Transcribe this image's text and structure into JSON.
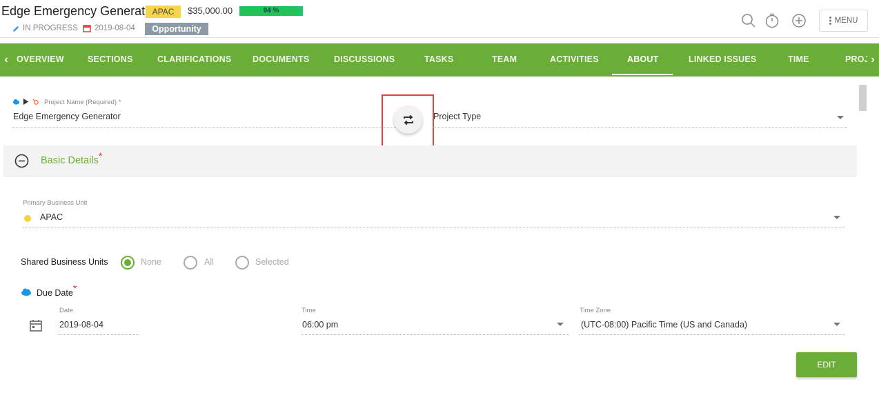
{
  "header": {
    "title": "Edge Emergency Generator",
    "business_unit_badge": "APAC",
    "amount": "$35,000.00",
    "progress": {
      "percent": 94,
      "label": "94 %"
    },
    "status": "IN PROGRESS",
    "date": "2019-08-04",
    "type_badge": "Opportunity",
    "menu_label": "MENU"
  },
  "nav": {
    "tabs": [
      {
        "label": "OVERVIEW"
      },
      {
        "label": "SECTIONS"
      },
      {
        "label": "CLARIFICATIONS"
      },
      {
        "label": "DOCUMENTS"
      },
      {
        "label": "DISCUSSIONS"
      },
      {
        "label": "TASKS"
      },
      {
        "label": "TEAM"
      },
      {
        "label": "ACTIVITIES"
      },
      {
        "label": "ABOUT"
      },
      {
        "label": "LINKED ISSUES"
      },
      {
        "label": "TIME"
      },
      {
        "label": "PROJECT"
      }
    ],
    "active": "ABOUT"
  },
  "form": {
    "project_name_label": "Project Name (Required) *",
    "project_name_value": "Edge Emergency Generator",
    "project_type_placeholder": "Project Type",
    "section_title": "Basic Details",
    "section_required": "*",
    "primary_bu_label": "Primary Business Unit",
    "primary_bu_value": "APAC",
    "shared_bu_label": "Shared Business Units",
    "shared_bu_options": [
      {
        "label": "None",
        "checked": true
      },
      {
        "label": "All",
        "checked": false
      },
      {
        "label": "Selected",
        "checked": false
      }
    ],
    "due_date_label": "Due Date",
    "due_date_required": "*",
    "date_label": "Date",
    "date_value": "2019-08-04",
    "time_label": "Time",
    "time_value": "06:00 pm",
    "timezone_label": "Time Zone",
    "timezone_value": "(UTC-08:00) Pacific Time (US and Canada)",
    "edit_button": "EDIT"
  },
  "colors": {
    "brand_green": "#6aae38",
    "apac_yellow": "#f7d54a",
    "progress_green": "#21c25a",
    "opportunity_gray": "#8b9aa6",
    "highlight_red": "#e3413c"
  }
}
